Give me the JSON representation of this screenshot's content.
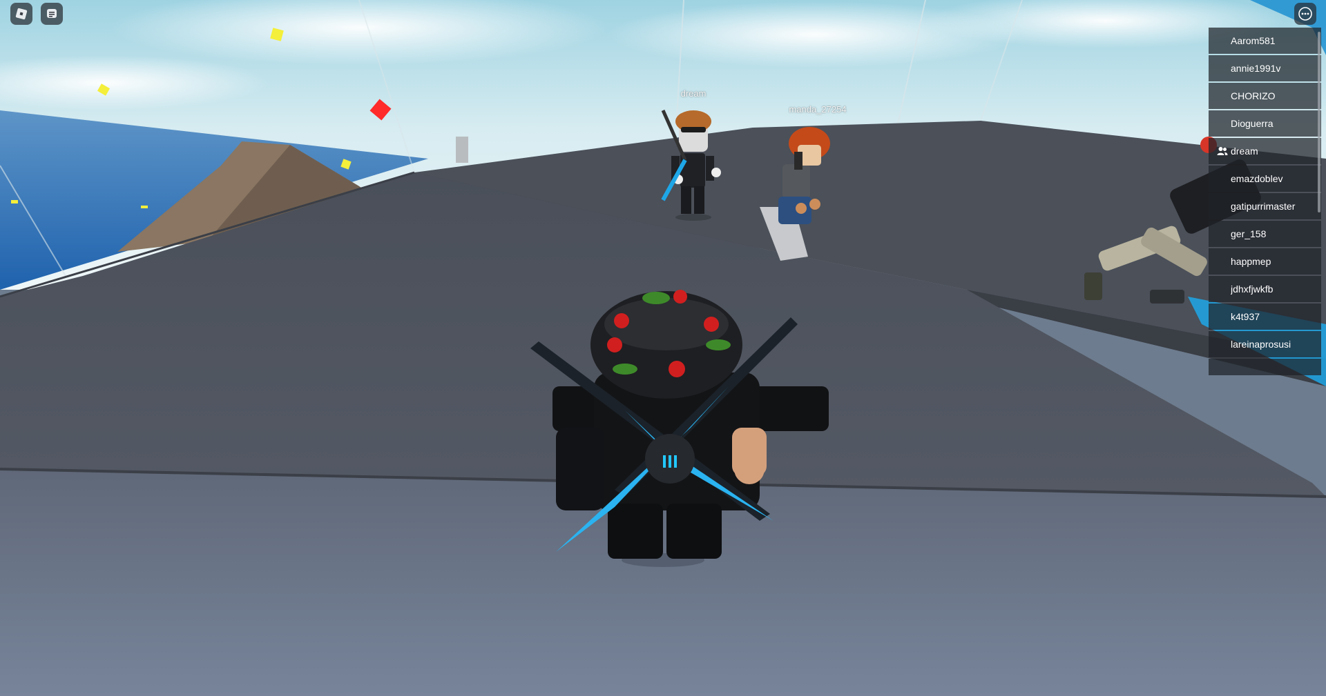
{
  "world": {
    "name_tags": {
      "dream": "dream",
      "manda": "manda_27254"
    }
  },
  "topbar": {
    "roblox_icon": "roblox-logo-icon",
    "chat_icon": "chat-icon",
    "menu_icon": "more-options-icon"
  },
  "player_list": {
    "players": [
      {
        "name": "Aarom581",
        "friend": false
      },
      {
        "name": "annie1991v",
        "friend": false
      },
      {
        "name": "CHORIZO",
        "friend": false
      },
      {
        "name": "Dioguerra",
        "friend": false
      },
      {
        "name": "dream",
        "friend": true
      },
      {
        "name": "emazdoblev",
        "friend": false
      },
      {
        "name": "gatipurrimaster",
        "friend": false
      },
      {
        "name": "ger_158",
        "friend": false
      },
      {
        "name": "happmep",
        "friend": false
      },
      {
        "name": "jdhxfjwkfb",
        "friend": false
      },
      {
        "name": "k4t937",
        "friend": false
      },
      {
        "name": "lareinaprosusi",
        "friend": false
      }
    ]
  },
  "colors": {
    "sky_top": "#bfe0ea",
    "sea": "#2f73b9",
    "floor": "#5c6474",
    "accent": "#1ea7e8"
  }
}
